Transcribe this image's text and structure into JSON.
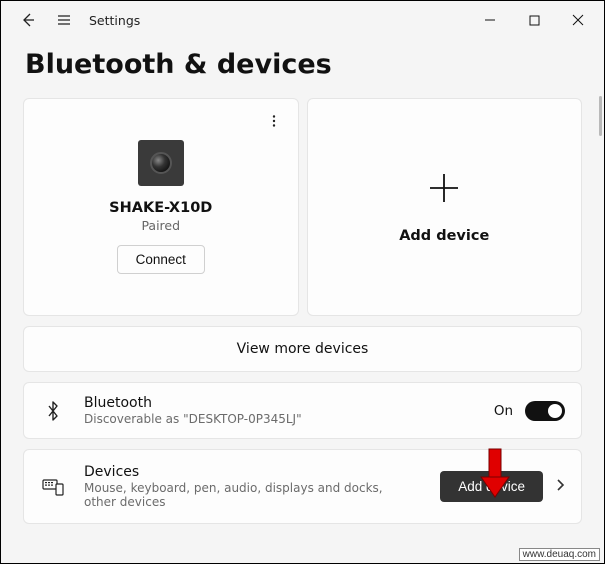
{
  "titlebar": {
    "title": "Settings"
  },
  "page": {
    "heading": "Bluetooth & devices"
  },
  "device_card": {
    "name": "SHAKE-X10D",
    "status": "Paired",
    "connect_label": "Connect"
  },
  "add_card": {
    "label": "Add device"
  },
  "view_more": {
    "label": "View more devices"
  },
  "bluetooth_row": {
    "title": "Bluetooth",
    "subtitle": "Discoverable as \"DESKTOP-0P345LJ\"",
    "toggle_label": "On",
    "toggle_state": true
  },
  "devices_row": {
    "title": "Devices",
    "subtitle": "Mouse, keyboard, pen, audio, displays and docks, other devices",
    "button_label": "Add device"
  },
  "watermark": "www.deuaq.com"
}
